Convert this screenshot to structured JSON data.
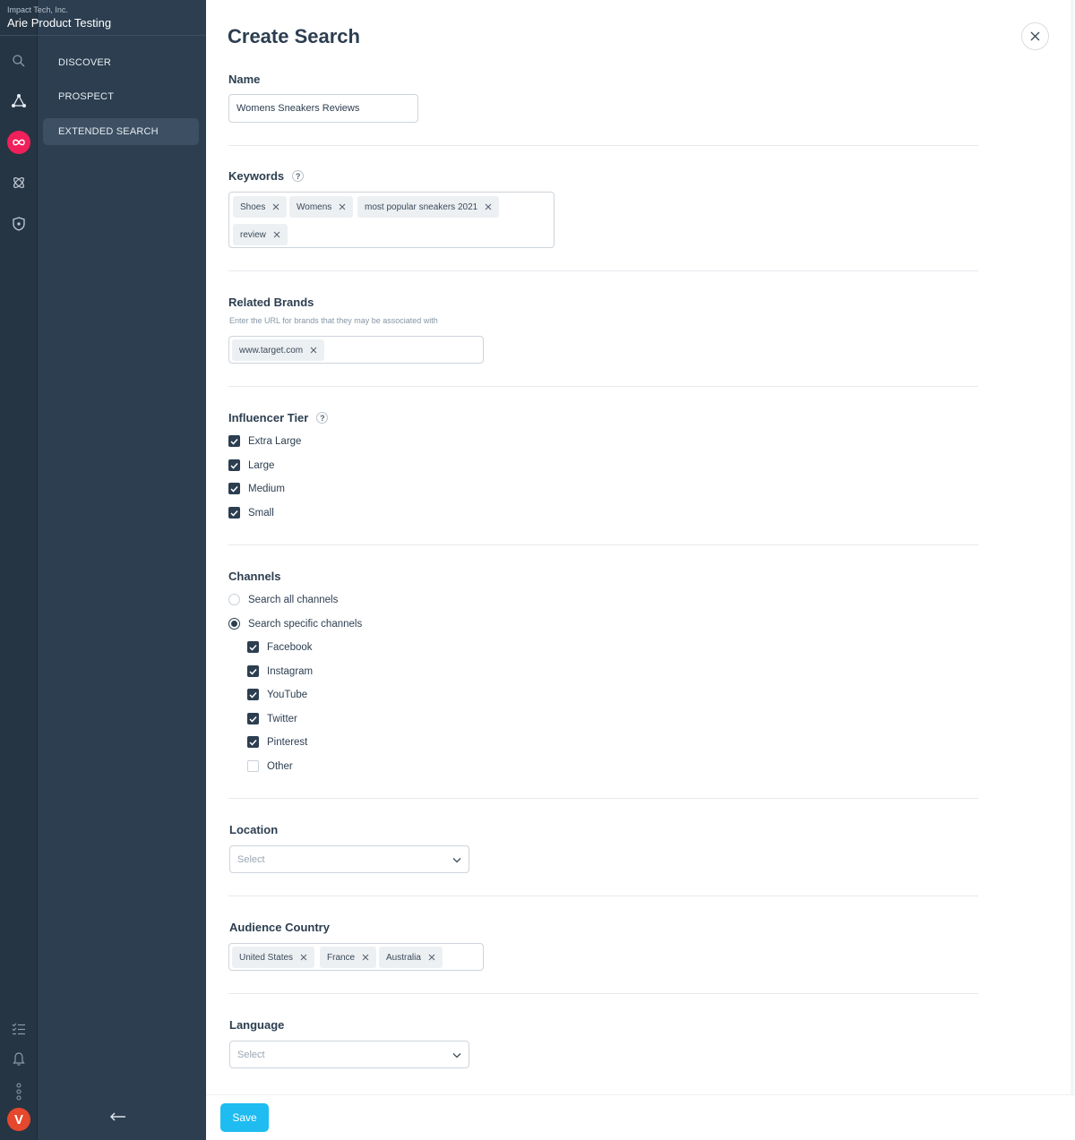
{
  "sidebar": {
    "org_name": "Impact Tech, Inc.",
    "project_name": "Arie Product Testing",
    "nav_items": [
      {
        "label": "DISCOVER"
      },
      {
        "label": "PROSPECT"
      },
      {
        "label": "EXTENDED SEARCH",
        "active": true
      }
    ],
    "rail_icons": [
      "search-icon",
      "network-icon",
      "infinity-icon",
      "atom-icon",
      "shield-icon",
      "checklist-icon",
      "bell-icon",
      "more-vertical-icon"
    ],
    "avatar_initial": "V",
    "colors": {
      "rail_bg": "#263544",
      "panel_bg": "#2c3e50",
      "active_item_bg": "#3c4f63",
      "infinity_badge": "#f0205a",
      "avatar_bg": "#e5482c"
    }
  },
  "form": {
    "title": "Create Search",
    "name": {
      "label": "Name",
      "value": "Womens Sneakers Reviews"
    },
    "keywords": {
      "label": "Keywords",
      "help": "?",
      "tags": [
        "Shoes",
        "Womens",
        "most popular sneakers 2021",
        "review"
      ]
    },
    "related_brands": {
      "label": "Related Brands",
      "hint": "Enter the URL for brands that they may be associated with",
      "tags": [
        "www.target.com"
      ]
    },
    "influencer_tier": {
      "label": "Influencer Tier",
      "help": "?",
      "options": [
        {
          "label": "Extra Large",
          "checked": true
        },
        {
          "label": "Large",
          "checked": true
        },
        {
          "label": "Medium",
          "checked": true
        },
        {
          "label": "Small",
          "checked": true
        }
      ]
    },
    "channels": {
      "label": "Channels",
      "radios": [
        {
          "label": "Search all channels",
          "selected": false
        },
        {
          "label": "Search specific channels",
          "selected": true
        }
      ],
      "options": [
        {
          "label": "Facebook",
          "checked": true
        },
        {
          "label": "Instagram",
          "checked": true
        },
        {
          "label": "YouTube",
          "checked": true
        },
        {
          "label": "Twitter",
          "checked": true
        },
        {
          "label": "Pinterest",
          "checked": true
        },
        {
          "label": "Other",
          "checked": false
        }
      ]
    },
    "location": {
      "label": "Location",
      "placeholder": "Select"
    },
    "audience_country": {
      "label": "Audience Country",
      "tags": [
        "United States",
        "France",
        "Australia"
      ]
    },
    "language": {
      "label": "Language",
      "placeholder": "Select"
    },
    "save_label": "Save",
    "colors": {
      "save_button": "#1ebcf0",
      "checkbox": "#2c3e50"
    }
  }
}
